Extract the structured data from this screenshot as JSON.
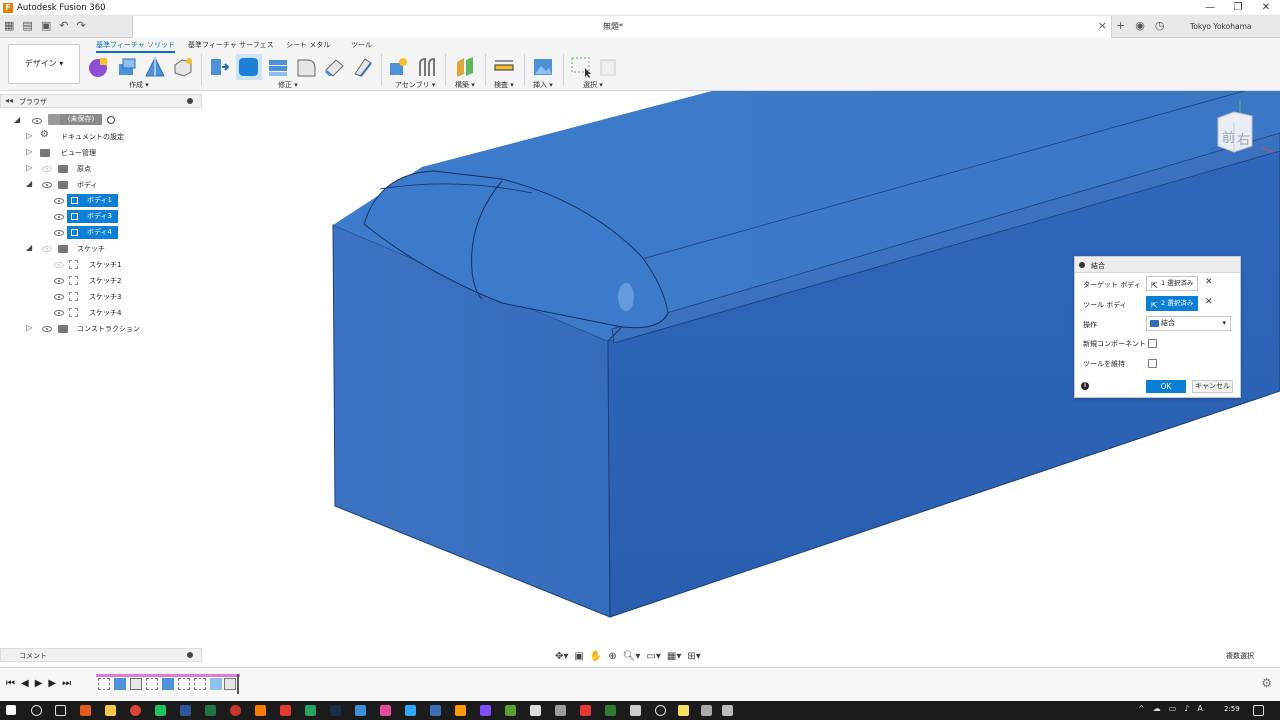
{
  "window": {
    "app_title": "Autodesk Fusion 360",
    "controls": [
      "—",
      "❐",
      "✕"
    ]
  },
  "qat": {
    "doc_title": "無題*",
    "user": "Tokyo Yokohama"
  },
  "ribbon": {
    "workspace": "デザイン ▾",
    "tabs": [
      "基準フィーチャ ソリッド",
      "基準フィーチャ サーフェス",
      "シート メタル",
      "ツール"
    ],
    "active_tab": 0,
    "groups": [
      "作成 ▾",
      "修正 ▾",
      "アセンブリ ▾",
      "構築 ▾",
      "検査 ▾",
      "挿入 ▾",
      "選択 ▾"
    ]
  },
  "browser": {
    "title": "ブラウザ",
    "root": "(未保存)",
    "items": [
      {
        "label": "ドキュメントの設定"
      },
      {
        "label": "ビュー管理"
      },
      {
        "label": "原点"
      },
      {
        "label": "ボディ"
      },
      {
        "label": "ボディ1"
      },
      {
        "label": "ボディ3"
      },
      {
        "label": "ボディ4"
      },
      {
        "label": "スケッチ"
      },
      {
        "label": "スケッチ1"
      },
      {
        "label": "スケッチ2"
      },
      {
        "label": "スケッチ3"
      },
      {
        "label": "スケッチ4"
      },
      {
        "label": "コンストラクション"
      }
    ]
  },
  "comment": {
    "title": "コメント"
  },
  "viewcube": {
    "front": "前",
    "right": "右"
  },
  "dialog": {
    "title": "結合",
    "target_label": "ターゲット ボディ",
    "target_value": "1 選択済み",
    "tool_label": "ツール ボディ",
    "tool_value": "2 選択済み",
    "operation_label": "操作",
    "operation_value": "結合",
    "new_component_label": "新規コンポーネント",
    "keep_tools_label": "ツールを維持",
    "ok": "OK",
    "cancel": "キャンセル"
  },
  "status": {
    "multi_select": "複数選択"
  },
  "taskbar": {
    "time": "2:59"
  },
  "colors": {
    "accent": "#0b7fd6",
    "model_blue": "#2f66b8",
    "model_top": "#3b78c9",
    "model_edge": "#1e3f74"
  }
}
